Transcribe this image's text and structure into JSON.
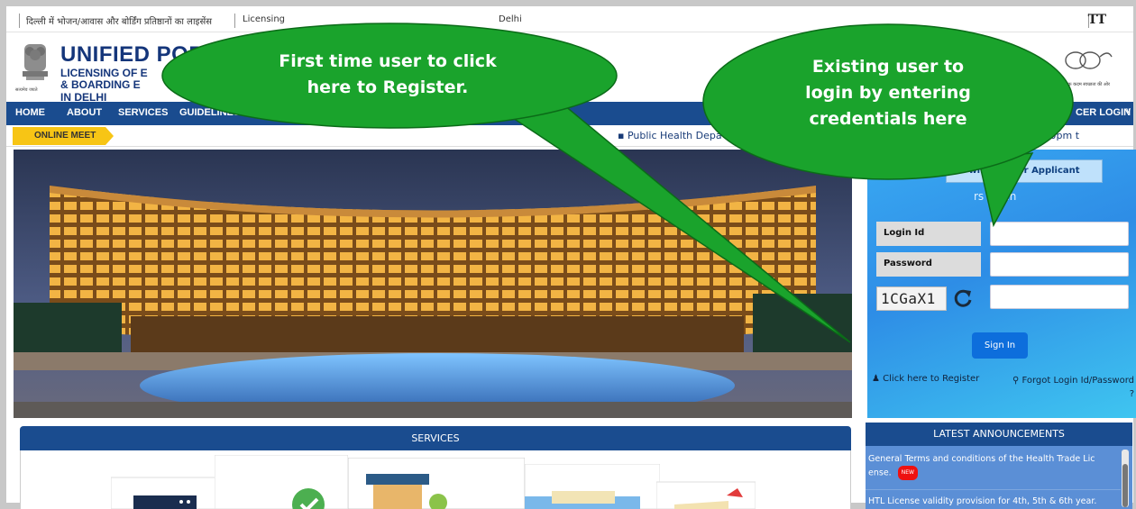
{
  "topbar": {
    "hindi_title": "दिल्ली में भोजन/आवास और बोर्डिंग प्रतिष्ठानों का लाइसेंस",
    "english_fragment": "Licensing",
    "english_tail": "Delhi",
    "text_size_label": "TT"
  },
  "header": {
    "title_line1": "UNIFIED POR",
    "title_line2a": "LICENSING OF E",
    "title_line2b": "& BOARDING E",
    "title_line3": "IN DELHI",
    "emblem_caption": "सत्यमेव जयते",
    "swachh_caption": "एक कदम स्वच्छता की ओर"
  },
  "nav": {
    "items": [
      "HOME",
      "ABOUT",
      "SERVICES",
      "GUIDELINES & D"
    ],
    "officer_login": "CER LOGIN"
  },
  "ticker": {
    "tag": "ONLINE MEET",
    "text_left": "Public Health Depa",
    "text_right": "y Friday 3:00pm t"
  },
  "login": {
    "downloads_button": "wnloads for Applicant",
    "panel_title": "rs Login",
    "login_id_label": "Login Id",
    "password_label": "Password",
    "captcha_text": "1CGaX1",
    "signin_button": "Sign In",
    "register_link": "Click here to Register",
    "forgot_link_line1": "Forgot Login Id/Password",
    "forgot_link_line2": "?"
  },
  "services": {
    "heading": "SERVICES"
  },
  "announcements": {
    "heading": "LATEST ANNOUNCEMENTS",
    "item1_line1": "General Terms and conditions of the Health Trade Lic",
    "item1_line2": "ense.",
    "new_badge": "NEW",
    "item2": "HTL License validity provision for 4th, 5th & 6th year."
  },
  "callouts": {
    "register_line1": "First time user to click",
    "register_line2": "here to Register.",
    "login_line1": "Existing user to",
    "login_line2": "login by entering",
    "login_line3": "credentials here"
  },
  "colors": {
    "callout_green": "#1aa32c",
    "nav_blue": "#1a4c8f",
    "ticker_yellow": "#f7c515"
  }
}
